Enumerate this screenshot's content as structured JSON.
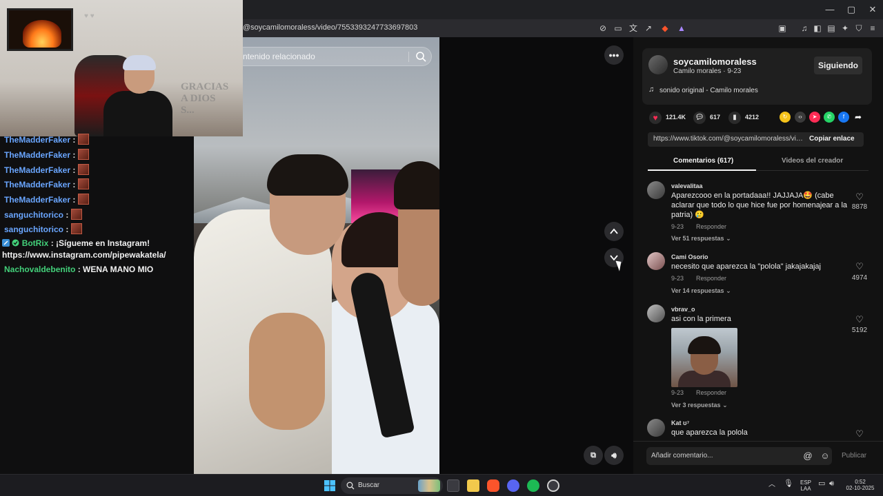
{
  "browser": {
    "url": "@soycamilomoraless/video/7553393247733697803",
    "window_controls": {
      "minimize": "—",
      "maximize": "▢",
      "close": "✕"
    },
    "toolbar_icons": [
      "reader-off-icon",
      "screen-cast-icon",
      "translate-icon",
      "share-icon",
      "brave-shield-icon",
      "brave-rewards-icon",
      "bookmark-icon",
      "media-icon",
      "sidebar-icon",
      "wallet-icon",
      "leo-ai-icon",
      "vpn-icon",
      "menu-icon"
    ]
  },
  "webcam": {
    "wall_text_1": "GRACIAS",
    "wall_text_2": "A DIOS",
    "wall_text_3": "S..."
  },
  "chat": {
    "messages": [
      {
        "user": "TheMadderFaker",
        "text": "",
        "emote": true
      },
      {
        "user": "TheMadderFaker",
        "text": "",
        "emote": true
      },
      {
        "user": "TheMadderFaker",
        "text": "",
        "emote": true
      },
      {
        "user": "TheMadderFaker",
        "text": "",
        "emote": true
      },
      {
        "user": "TheMadderFaker",
        "text": "",
        "emote": true
      },
      {
        "user": "sanguchitorico",
        "text": "",
        "emote": true
      },
      {
        "user": "sanguchitorico",
        "text": "",
        "emote": true
      },
      {
        "user": "BotRix",
        "text": "¡Sígueme en Instagram!",
        "emote": false
      },
      {
        "user": "",
        "text": "https://www.instagram.com/pipewakatela/",
        "emote": false
      },
      {
        "user": "Nachovaldebenito",
        "text": "WENA MANO MIO",
        "emote": false
      }
    ]
  },
  "video": {
    "search_placeholder": "ntenido relacionado"
  },
  "creator": {
    "username": "soycamilomoraless",
    "subtitle": "Camilo morales · 9-23",
    "follow_label": "Siguiendo",
    "music": "sonido original - Camilo morales"
  },
  "stats": {
    "likes": "121.4K",
    "comments": "617",
    "saves": "4212"
  },
  "share": {
    "link": "https://www.tiktok.com/@soycamilomoraless/video/7553393247733697803",
    "copy_label": "Copiar enlace"
  },
  "tabs": {
    "comments": "Comentarios (617)",
    "creator_videos": "Videos del creador"
  },
  "comments": [
    {
      "user": "valevalitaa",
      "text": "Aparezcooo en la portadaaa!! JAJJAJA🤩 (cabe aclarar que todo lo que hice fue por homenajear a la patria) 🥲",
      "date": "9-23",
      "reply": "Responder",
      "more": "Ver 51 respuestas",
      "likes": "8878"
    },
    {
      "user": "Cami Osorio",
      "text": "necesito que aparezca la \"polola\" jakajakajaj",
      "date": "9-23",
      "reply": "Responder",
      "more": "Ver 14 respuestas",
      "likes": "4974"
    },
    {
      "user": "vbrav_o",
      "text": "asi con la primera",
      "date": "9-23",
      "reply": "Responder",
      "more": "Ver 3 respuestas",
      "likes": "5192"
    },
    {
      "user": "Kat ʊ⁷",
      "text": "que aparezca la polola",
      "date": "",
      "reply": "",
      "more": "",
      "likes": ""
    }
  ],
  "comment_box": {
    "placeholder": "Añadir comentario...",
    "publish_label": "Publicar"
  },
  "taskbar": {
    "search_label": "Buscar",
    "lang_top": "ESP",
    "lang_bottom": "LAA",
    "time": "0:52",
    "date": "02-10-2025"
  },
  "colors": {
    "chat_user": "#6aa6ff",
    "botrix": "#43d17a",
    "heart": "#fe2c55"
  }
}
